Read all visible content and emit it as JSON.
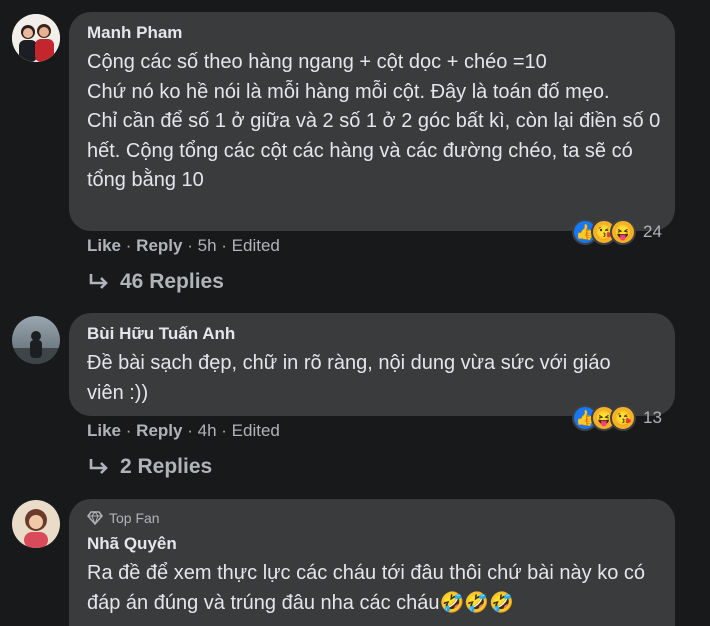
{
  "comments": [
    {
      "author": "Manh Pham",
      "text": "Cộng các số theo hàng ngang + cột dọc + chéo =10\nChứ nó ko hề nói là mỗi hàng mỗi cột. Đây là toán đố mẹo.\nChỉ cần để số 1 ở giữa và 2 số 1 ở 2 góc bất kì, còn lại điền số 0 hết. Cộng tổng các cột các hàng và các đường chéo, ta sẽ có tổng bằng 10",
      "like_label": "Like",
      "reply_label": "Reply",
      "time": "5h",
      "edited": "Edited",
      "reaction_count": "24",
      "replies_label": "46 Replies"
    },
    {
      "author": "Bùi Hữu Tuấn Anh",
      "text": "Đề bài sạch đẹp, chữ in rõ ràng, nội dung vừa sức với giáo viên :))",
      "like_label": "Like",
      "reply_label": "Reply",
      "time": "4h",
      "edited": "Edited",
      "reaction_count": "13",
      "replies_label": "2 Replies"
    },
    {
      "badge": "Top Fan",
      "author": "Nhã Quyên",
      "text": "Ra đề để xem thực lực các cháu tới đâu thôi chứ bài này ko có đáp án đúng và trúng đâu nha các cháu🤣🤣🤣"
    }
  ],
  "separators": {
    "dot": "·"
  },
  "colors": {
    "background": "#18191a",
    "bubble": "#3a3b3c",
    "text": "#e4e6eb",
    "secondary": "#b0b3b8",
    "like_blue": "#1877f2"
  },
  "icons": [
    "like-reaction-icon",
    "haha-reaction-icon",
    "wow-reaction-icon",
    "reply-arrow-icon",
    "diamond-icon"
  ]
}
